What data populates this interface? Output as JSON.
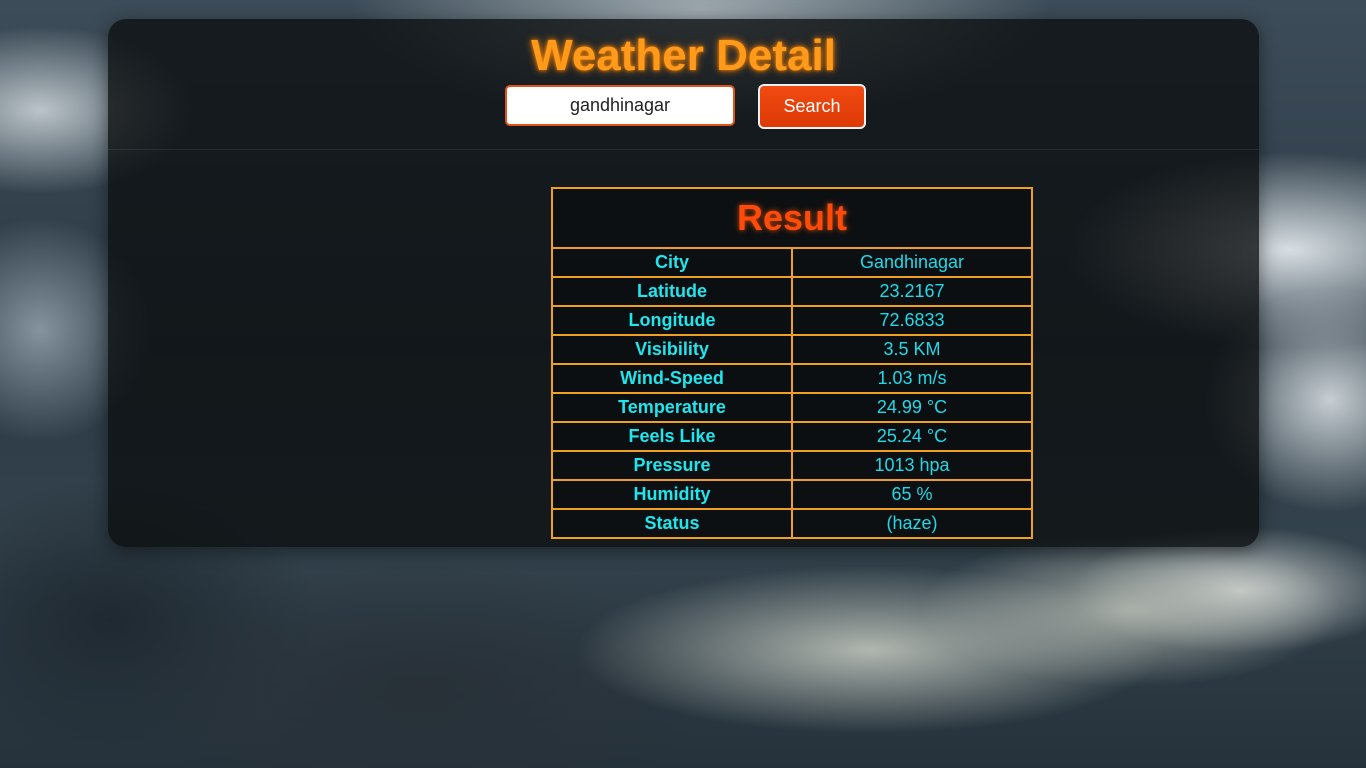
{
  "header": {
    "title": "Weather Detail",
    "search": {
      "value": "gandhinagar",
      "button_label": "Search"
    }
  },
  "result": {
    "caption": "Result",
    "rows": [
      {
        "label": "City",
        "value": "Gandhinagar"
      },
      {
        "label": "Latitude",
        "value": "23.2167"
      },
      {
        "label": "Longitude",
        "value": "72.6833"
      },
      {
        "label": "Visibility",
        "value": "3.5 KM"
      },
      {
        "label": "Wind-Speed",
        "value": "1.03 m/s"
      },
      {
        "label": "Temperature",
        "value": "24.99 °C"
      },
      {
        "label": "Feels Like",
        "value": "25.24 °C"
      },
      {
        "label": "Pressure",
        "value": "1013 hpa"
      },
      {
        "label": "Humidity",
        "value": "65 %"
      },
      {
        "label": "Status",
        "value": "(haze)"
      }
    ]
  },
  "colors": {
    "title": "#ff9a1a",
    "result_caption": "#ff4a0a",
    "table_border": "#f0a020",
    "label_text": "#1fe5ec",
    "button": "#f24a12"
  }
}
